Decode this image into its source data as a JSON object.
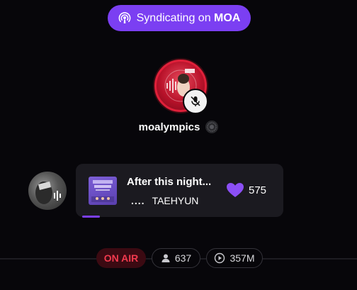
{
  "syndication": {
    "prefix": "Syndicating on ",
    "platform": "MOA",
    "icon": "podcast-broadcast-icon"
  },
  "host": {
    "name": "moalympics",
    "avatar_ring_color": "#e0203a",
    "mic_status_icon": "mic-off-icon",
    "badge_icon": "verified-badge-icon"
  },
  "listener": {
    "avatar_icon": "sound-wave-icon"
  },
  "now_playing": {
    "title": "After this night...",
    "eq_indicator": "....",
    "artist": "TAEHYUN",
    "likes": "575",
    "like_icon": "heart-icon",
    "progress_fraction": 0.09
  },
  "stats": {
    "status": "ON AIR",
    "listeners": "637",
    "plays": "357M",
    "listeners_icon": "person-icon",
    "plays_icon": "play-circle-icon"
  },
  "colors": {
    "accent": "#7b3ff2",
    "background": "#07060a",
    "card": "#1b1a20",
    "on_air": "#f23a4e"
  }
}
